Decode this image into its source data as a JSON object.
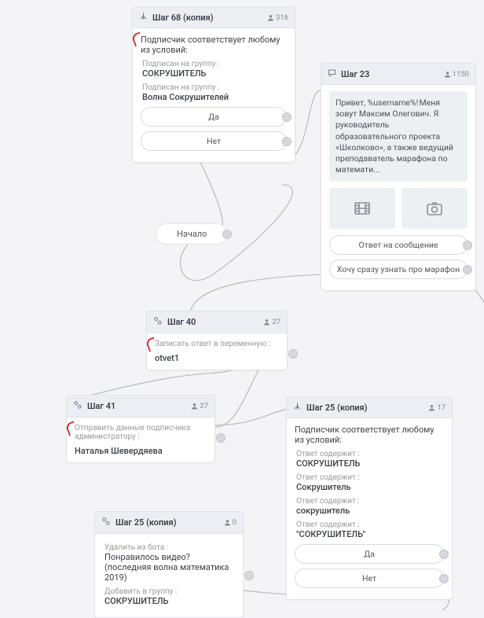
{
  "start": {
    "label": "Начало"
  },
  "step68": {
    "title": "Шаг 68 (копия)",
    "count": "316",
    "heading": "Подписчик соответствует любому из условий:",
    "cond1_label": "Подписан на группу :",
    "cond1_value": "СОКРУШИТЕЛЬ",
    "cond2_label": "Подписан на группу :",
    "cond2_value": "Волна Сокрушителей",
    "yes": "Да",
    "no": "Нет"
  },
  "step23": {
    "title": "Шаг 23",
    "count": "1150",
    "message": "Привет, %username%! Меня зовут Максим Олегович. Я руководитель образовательного проекта «Школково», а также ведущий преподаватель марафона по математи...",
    "reply": "Ответ на сообщение",
    "more": "Хочу сразу узнать про марафон"
  },
  "step40": {
    "title": "Шаг 40",
    "count": "27",
    "label": "Записать ответ в переменную :",
    "value": "otvet1"
  },
  "step41": {
    "title": "Шаг 41",
    "count": "27",
    "label": "Отправить данные подписчика администратору :",
    "value": "Наталья Шевердяева"
  },
  "step25a": {
    "title": "Шаг 25 (копия)",
    "count": "17",
    "heading": "Подписчик соответствует любому из условий:",
    "c1_label": "Ответ содержит :",
    "c1_value": "СОКРУШИТЕЛЬ",
    "c2_label": "Ответ содержит :",
    "c2_value": "Сокрушитель",
    "c3_label": "Ответ содержит :",
    "c3_value": "сокрушитель",
    "c4_label": "Ответ содержит :",
    "c4_value": "\"СОКРУШИТЕЛЬ\"",
    "yes": "Да",
    "no": "Нет"
  },
  "step25b": {
    "title": "Шаг 25 (копия)",
    "count": "0",
    "del_label": "Удалить из бота :",
    "del_value": "Понравилось видео? (последняя волна математика 2019)",
    "add_label": "Добавить в группу :",
    "add_value": "СОКРУШИТЕЛЬ"
  }
}
